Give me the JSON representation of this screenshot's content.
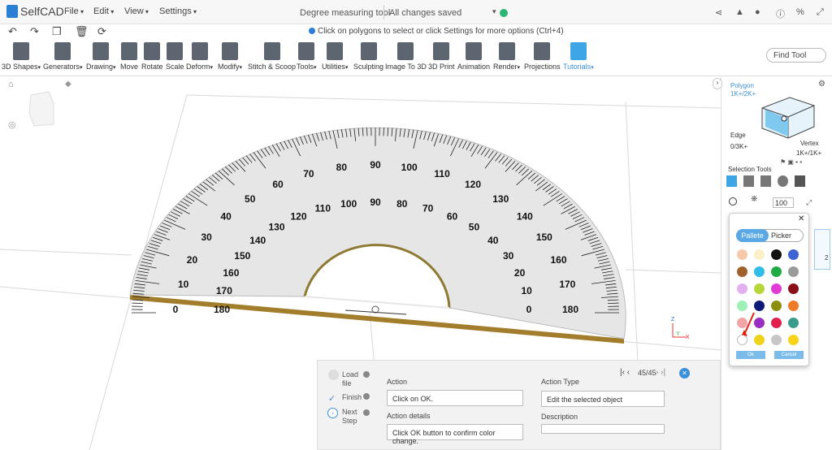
{
  "app": {
    "name": "SelfCAD"
  },
  "menu": [
    "File",
    "Edit",
    "View",
    "Settings"
  ],
  "doc": {
    "title": "Degree measuring tool",
    "status": "All changes saved"
  },
  "hint": "Click on polygons to select or click Settings for more options (Ctrl+4)",
  "toolbar": [
    "3D Shapes",
    "Generators",
    "Drawing",
    "Move",
    "Rotate",
    "Scale",
    "Deform",
    "Modify",
    "Stitch & Scoop",
    "Tools",
    "Utilities",
    "Sculpting",
    "Image To 3D",
    "3D Print",
    "Animation",
    "Render",
    "Projections",
    "Tutorials"
  ],
  "find_tool": "Find Tool",
  "protractor": {
    "outer_ticks": [
      "10",
      "20",
      "30",
      "40",
      "50",
      "60",
      "70",
      "80",
      "90",
      "100",
      "110",
      "120",
      "130",
      "140",
      "150",
      "160",
      "170",
      "180"
    ],
    "inner_ticks": [
      "180",
      "170",
      "160",
      "150",
      "140",
      "130",
      "120",
      "110",
      "100",
      "90",
      "80",
      "70",
      "60",
      "50",
      "40",
      "30",
      "20",
      "10",
      "0"
    ],
    "left_zero": "0",
    "right_zero": "0",
    "right_180": "180"
  },
  "right_panel": {
    "polygon": "Polygon",
    "polygon_count": "1K+/2K+",
    "edge": "Edge",
    "edge_count": "0/3K+",
    "vertex": "Vertex",
    "vertex_count": "1K+/1K+",
    "selection_tools": "Selection Tools",
    "size": "100",
    "partial_num": "2"
  },
  "palette": {
    "tabs": [
      "Pallete",
      "Picker"
    ],
    "ok": "Ok",
    "cancel": "Cancel",
    "colors": [
      "#f6c9a8",
      "#fbf0c8",
      "#111111",
      "#3b63d3",
      "#a0622c",
      "#30bde7",
      "#22aa44",
      "#9b9b9b",
      "#e2b2f0",
      "#b7d63a",
      "#e23ad6",
      "#8a0f18",
      "#9ff0b7",
      "#0f1a78",
      "#8b8f0d",
      "#f07a2a",
      "#f3a4a4",
      "#9a2ec2",
      "#e1204d",
      "#3a9c8c",
      "#ffffff",
      "#f0d21a",
      "#c7c7c7",
      "#f7d31a"
    ]
  },
  "tutorial": {
    "steps": [
      "Load file",
      "Finish",
      "Next Step"
    ],
    "action_label": "Action",
    "action_value": "Click on OK.",
    "details_label": "Action details",
    "details_value": "Click OK button to confirm color change.",
    "type_label": "Action Type",
    "type_value": "Edit the selected object",
    "desc_label": "Description",
    "desc_value": "",
    "counter": "45/45"
  },
  "icons": [
    "share-icon",
    "bell-icon",
    "user-icon",
    "info-icon",
    "percent-icon",
    "expand-icon",
    "undo-icon",
    "redo-icon",
    "copy-icon",
    "trash-icon",
    "refresh-icon",
    "home-icon",
    "close-icon"
  ]
}
